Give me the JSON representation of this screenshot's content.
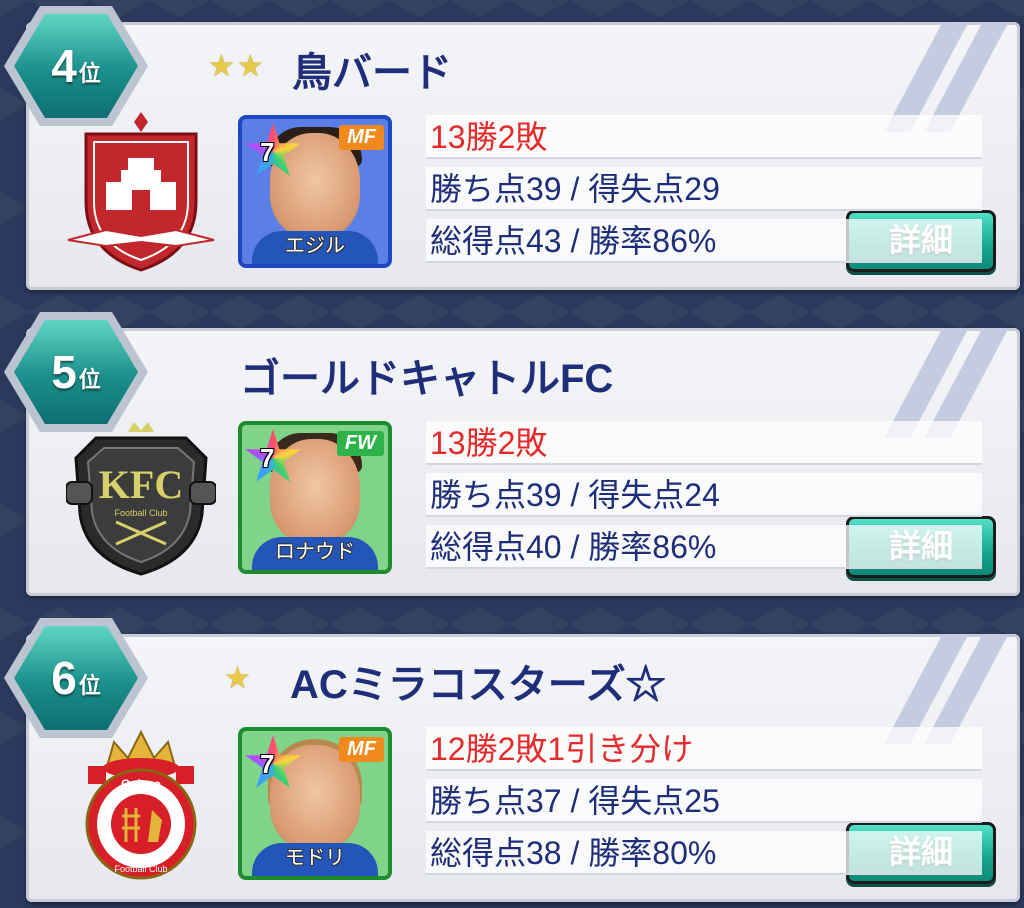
{
  "entries": [
    {
      "rank": "4",
      "rank_suffix": "位",
      "stars": 2,
      "team_name": "鳥バード",
      "player": {
        "name": "エジル",
        "position": "MF",
        "rarity": "7",
        "card_color": "blue"
      },
      "record": "13勝2敗",
      "points_line": "勝ち点39 / 得失点29",
      "goals_line": "総得点43 / 勝率86%",
      "detail_label": "詳細"
    },
    {
      "rank": "5",
      "rank_suffix": "位",
      "stars": 0,
      "team_name": "ゴールドキャトルFC",
      "player": {
        "name": "ロナウド",
        "position": "FW",
        "rarity": "7",
        "card_color": "green"
      },
      "record": "13勝2敗",
      "points_line": "勝ち点39 / 得失点24",
      "goals_line": "総得点40 / 勝率86%",
      "detail_label": "詳細"
    },
    {
      "rank": "6",
      "rank_suffix": "位",
      "stars": 1,
      "team_name": "ACミラコスターズ☆",
      "player": {
        "name": "モドリ",
        "position": "MF",
        "rarity": "7",
        "card_color": "green"
      },
      "record": "12勝2敗1引き分け",
      "points_line": "勝ち点37 / 得失点25",
      "goals_line": "総得点38 / 勝率80%",
      "detail_label": "詳細"
    }
  ],
  "emblems": [
    {
      "icon": "castle-shield-emblem-icon",
      "color": "#c1272d"
    },
    {
      "icon": "kfc-crest-emblem-icon",
      "color": "#2b2b2b",
      "text": "KFC",
      "subtext": "Football Club"
    },
    {
      "icon": "crown-roundel-emblem-icon",
      "color": "#d61f26",
      "text": "Golazo",
      "subtext": "Football Club"
    }
  ],
  "colors": {
    "record_red": "#e42a2a",
    "text_navy": "#1e2e78",
    "rank_teal": "#1a8f8c",
    "button_teal": "#16a58e",
    "star_gold": "#e8c94a"
  }
}
